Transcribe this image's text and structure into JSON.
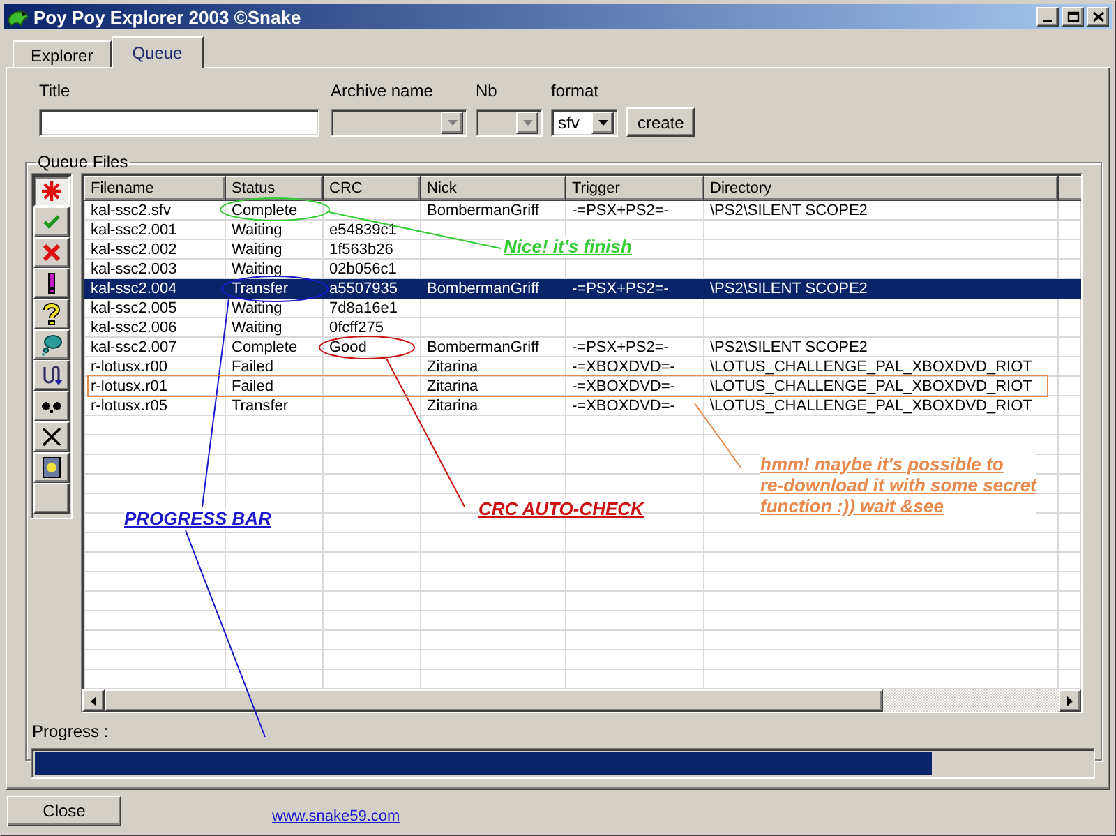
{
  "window": {
    "title": "Poy Poy Explorer 2003 ©Snake"
  },
  "tabs": [
    {
      "label": "Explorer",
      "selected": false
    },
    {
      "label": "Queue",
      "selected": true
    }
  ],
  "form": {
    "title_label": "Title",
    "archive_label": "Archive name",
    "nb_label": "Nb",
    "format_label": "format",
    "archive_disabled": true,
    "nb_disabled": true,
    "format_value": "sfv",
    "create_button": "create"
  },
  "queue": {
    "legend": "Queue Files",
    "tools": [
      {
        "kind": "asterisk",
        "selected": true
      },
      {
        "kind": "check",
        "selected": false
      },
      {
        "kind": "cross",
        "selected": false
      },
      {
        "kind": "exclaim",
        "selected": false
      },
      {
        "kind": "question",
        "selected": false
      },
      {
        "kind": "bubble",
        "selected": false
      },
      {
        "kind": "uturn",
        "selected": false
      },
      {
        "kind": "stars",
        "selected": false
      },
      {
        "kind": "xmark",
        "selected": false
      },
      {
        "kind": "picture",
        "selected": false
      },
      {
        "kind": "blank",
        "selected": false
      }
    ],
    "columns": [
      "Filename",
      "Status",
      "CRC",
      "Nick",
      "Trigger",
      "Directory"
    ],
    "rows": [
      {
        "filename": "kal-ssc2.sfv",
        "status": "Complete",
        "nick": "BombermanGriff",
        "trigger": "-=PSX+PS2=-",
        "directory": "\\PS2\\SILENT SCOPE2",
        "selected": false
      },
      {
        "filename": "kal-ssc2.001",
        "status": "Waiting",
        "crc": "e54839c1",
        "selected": false
      },
      {
        "filename": "kal-ssc2.002",
        "status": "Waiting",
        "crc": "1f563b26",
        "selected": false
      },
      {
        "filename": "kal-ssc2.003",
        "status": "Waiting",
        "crc": "02b056c1",
        "selected": false
      },
      {
        "filename": "kal-ssc2.004",
        "status": "Transfer",
        "crc": "a5507935",
        "nick": "BombermanGriff",
        "trigger": "-=PSX+PS2=-",
        "directory": "\\PS2\\SILENT SCOPE2",
        "selected": true
      },
      {
        "filename": "kal-ssc2.005",
        "status": "Waiting",
        "crc": "7d8a16e1",
        "selected": false
      },
      {
        "filename": "kal-ssc2.006",
        "status": "Waiting",
        "crc": "0fcff275",
        "selected": false
      },
      {
        "filename": "kal-ssc2.007",
        "status": "Complete",
        "crc": "Good",
        "nick": "BombermanGriff",
        "trigger": "-=PSX+PS2=-",
        "directory": "\\PS2\\SILENT SCOPE2",
        "selected": false
      },
      {
        "filename": "r-lotusx.r00",
        "status": "Failed",
        "nick": "Zitarina",
        "trigger": "-=XBOXDVD=-",
        "directory": "\\LOTUS_CHALLENGE_PAL_XBOXDVD_RIOT",
        "selected": false
      },
      {
        "filename": "r-lotusx.r01",
        "status": "Failed",
        "nick": "Zitarina",
        "trigger": "-=XBOXDVD=-",
        "directory": "\\LOTUS_CHALLENGE_PAL_XBOXDVD_RIOT",
        "selected": false
      },
      {
        "filename": "r-lotusx.r05",
        "status": "Transfer",
        "nick": "Zitarina",
        "trigger": "-=XBOXDVD=-",
        "directory": "\\LOTUS_CHALLENGE_PAL_XBOXDVD_RIOT",
        "selected": false
      }
    ],
    "progress_label": "Progress :",
    "progress": {
      "level": 0.85
    }
  },
  "annotations": [
    {
      "kind": "ellipse",
      "color": "#33cc33",
      "text": "Nice! it's finish"
    },
    {
      "kind": "ellipse",
      "color": "#1a1acc",
      "text": "PROGRESS BAR"
    },
    {
      "kind": "ellipse",
      "color": "#cc1111",
      "text": "CRC AUTO-CHECK"
    },
    {
      "kind": "rectangle",
      "color": "#e8884a",
      "text": "hmm! maybe it's possible to\nre-download it with some secret\nfunction :)) wait &see"
    }
  ],
  "footer": {
    "close_button": "Close",
    "link": "www.snake59.com"
  }
}
